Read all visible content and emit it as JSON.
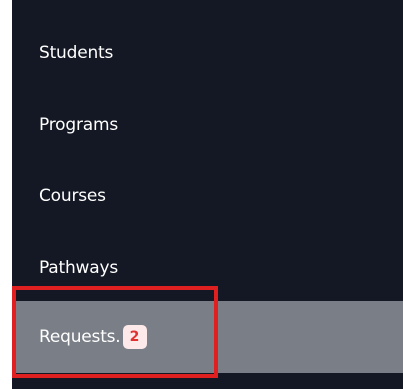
{
  "sidebar": {
    "items": [
      {
        "label": "Students"
      },
      {
        "label": "Programs"
      },
      {
        "label": "Courses"
      },
      {
        "label": "Pathways"
      },
      {
        "label": "Requests.",
        "badge": "2",
        "active": true
      }
    ]
  },
  "colors": {
    "sidebar_bg": "#141824",
    "active_bg": "#7a7e86",
    "badge_bg": "#fde8ea",
    "badge_text": "#e03131",
    "highlight": "#e02020"
  }
}
